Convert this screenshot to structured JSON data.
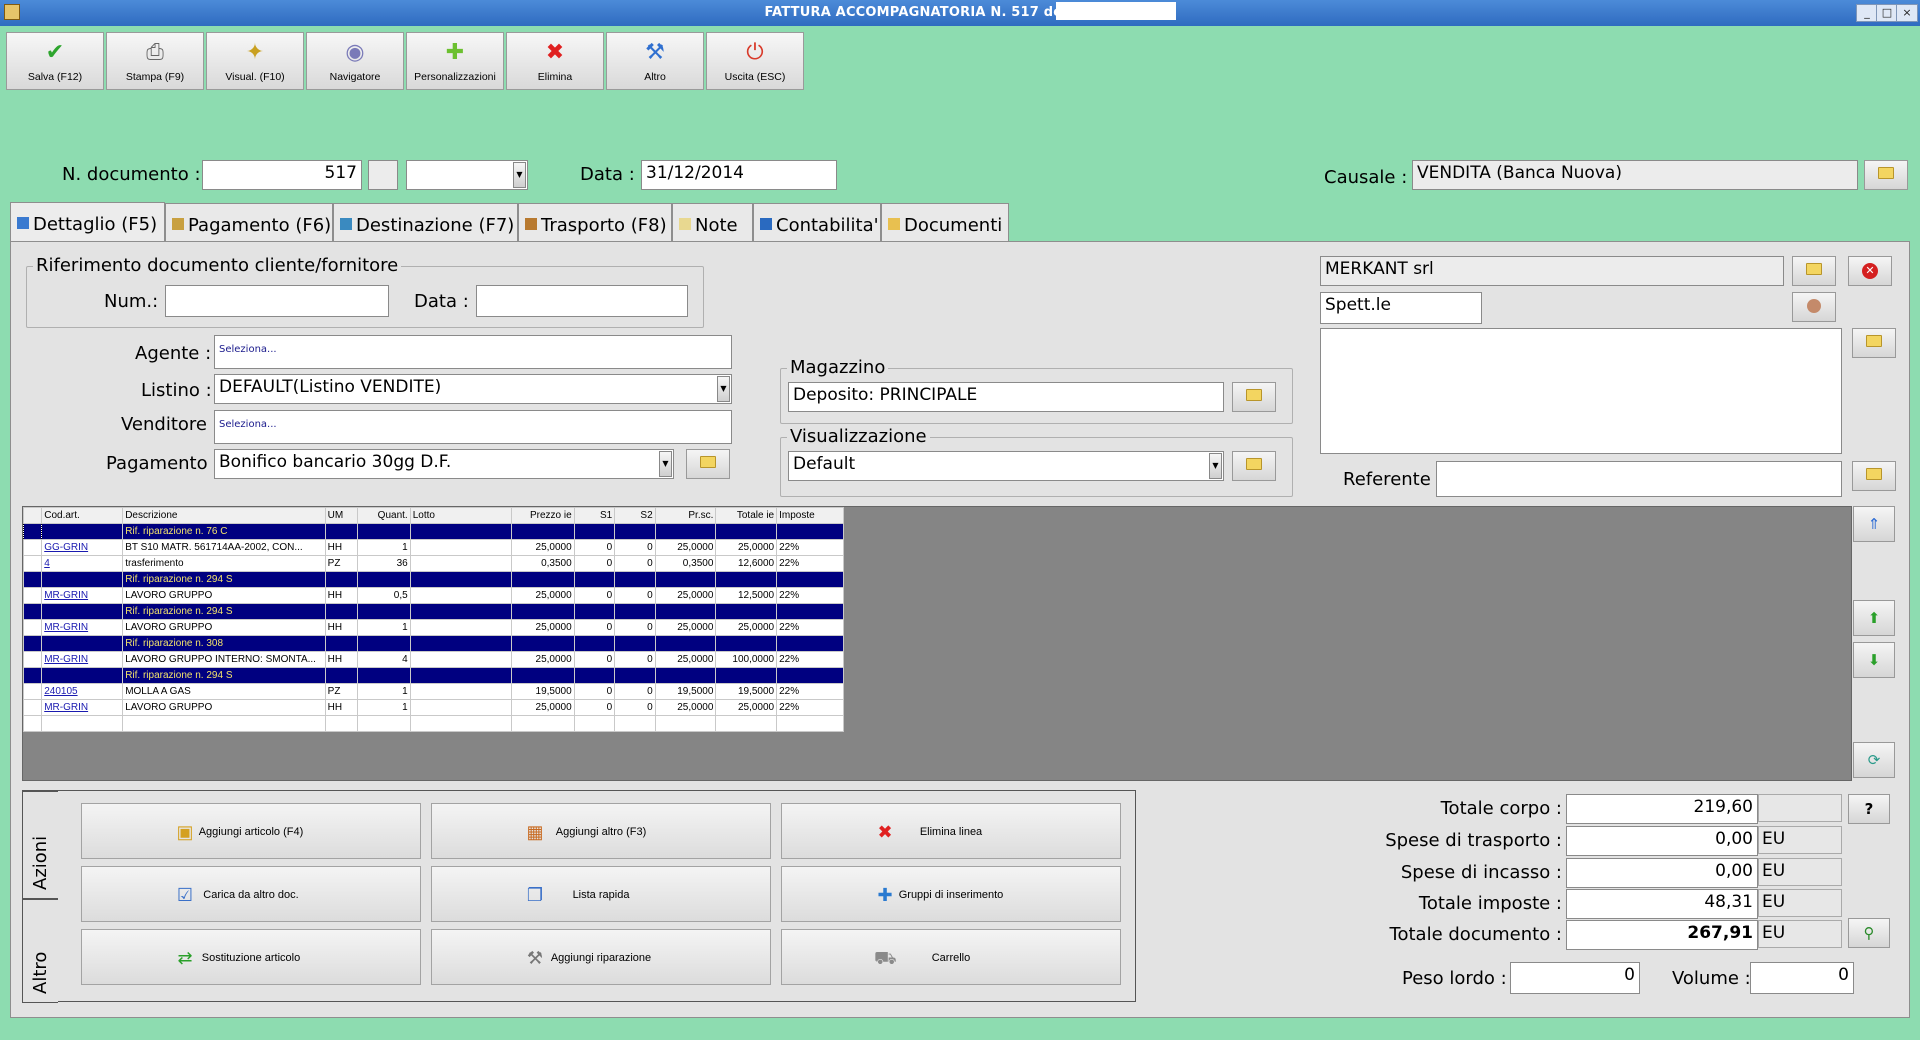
{
  "window": {
    "title": "FATTURA ACCOMPAGNATORIA N. 517 del 31/12/2014",
    "minimize": "_",
    "maximize": "□",
    "close": "×"
  },
  "toolbar": [
    {
      "label": "Salva (F12)",
      "icon": "check-icon",
      "color": "#2ea52e"
    },
    {
      "label": "Stampa (F9)",
      "icon": "printer-icon",
      "color": "#666666"
    },
    {
      "label": "Visual. (F10)",
      "icon": "magic-wand-icon",
      "color": "#c9a020"
    },
    {
      "label": "Navigatore",
      "icon": "navigator-icon",
      "color": "#7a7ab8"
    },
    {
      "label": "Personalizzazioni",
      "icon": "puzzle-icon",
      "color": "#6cc030"
    },
    {
      "label": "Elimina",
      "icon": "red-x-icon",
      "color": "#e02020"
    },
    {
      "label": "Altro",
      "icon": "tools-icon",
      "color": "#3070d0"
    },
    {
      "label": "Uscita (ESC)",
      "icon": "power-icon",
      "color": "#d83a2a"
    }
  ],
  "header": {
    "ndoc_label": "N. documento :",
    "ndoc_value": "517",
    "data_label": "Data :",
    "data_value": "31/12/2014",
    "causale_label": "Causale :",
    "causale_value": "VENDITA (Banca Nuova)"
  },
  "tabs": [
    {
      "label": "Dettaglio (F5)"
    },
    {
      "label": "Pagamento (F6)"
    },
    {
      "label": "Destinazione (F7)"
    },
    {
      "label": "Trasporto (F8)"
    },
    {
      "label": "Note"
    },
    {
      "label": "Contabilita'"
    },
    {
      "label": "Documenti"
    }
  ],
  "riferimento": {
    "title": "Riferimento documento cliente/fornitore",
    "num_label": "Num.:",
    "num_value": "",
    "data_label": "Data :",
    "data_value": ""
  },
  "fields": {
    "agente_label": "Agente :",
    "agente_value": "Seleziona...",
    "listino_label": "Listino :",
    "listino_value": "DEFAULT(Listino VENDITE)",
    "venditore_label": "Venditore :",
    "venditore_value": "Seleziona...",
    "pagamento_label": "Pagamento :",
    "pagamento_value": "Bonifico bancario 30gg D.F."
  },
  "magazzino": {
    "title": "Magazzino",
    "value": "Deposito: PRINCIPALE"
  },
  "visualizzazione": {
    "title": "Visualizzazione",
    "value": "Default"
  },
  "cliente": {
    "name": "MERKANT srl",
    "salutation": "Spett.le",
    "address": "",
    "referente_label": "Referente",
    "referente_value": ""
  },
  "grid": {
    "columns": [
      "Cod.art.",
      "Descrizione",
      "UM",
      "Quant.",
      "Lotto",
      "Prezzo ie",
      "S1",
      "S2",
      "Pr.sc.",
      "Totale ie",
      "Imposte"
    ],
    "rows": [
      {
        "type": "rif",
        "desc": "Rif. riparazione n. 76 C"
      },
      {
        "type": "item",
        "code": "GG-GRIN",
        "desc": "BT S10 MATR. 561714AA-2002, CON...",
        "um": "HH",
        "qty": "1",
        "lotto": "",
        "price": "25,0000",
        "s1": "0",
        "s2": "0",
        "prsc": "25,0000",
        "total": "25,0000",
        "tax": "22%"
      },
      {
        "type": "item",
        "code": "4",
        "desc": "trasferimento",
        "um": "PZ",
        "qty": "36",
        "lotto": "",
        "price": "0,3500",
        "s1": "0",
        "s2": "0",
        "prsc": "0,3500",
        "total": "12,6000",
        "tax": "22%"
      },
      {
        "type": "rif",
        "desc": "Rif. riparazione n. 294 S"
      },
      {
        "type": "item",
        "code": "MR-GRIN",
        "desc": "LAVORO GRUPPO",
        "um": "HH",
        "qty": "0,5",
        "lotto": "",
        "price": "25,0000",
        "s1": "0",
        "s2": "0",
        "prsc": "25,0000",
        "total": "12,5000",
        "tax": "22%"
      },
      {
        "type": "rif",
        "desc": "Rif. riparazione n. 294 S"
      },
      {
        "type": "item",
        "code": "MR-GRIN",
        "desc": "LAVORO GRUPPO",
        "um": "HH",
        "qty": "1",
        "lotto": "",
        "price": "25,0000",
        "s1": "0",
        "s2": "0",
        "prsc": "25,0000",
        "total": "25,0000",
        "tax": "22%"
      },
      {
        "type": "rif",
        "desc": "Rif. riparazione n. 308"
      },
      {
        "type": "item",
        "code": "MR-GRIN",
        "desc": "LAVORO GRUPPO INTERNO: SMONTA...",
        "um": "HH",
        "qty": "4",
        "lotto": "",
        "price": "25,0000",
        "s1": "0",
        "s2": "0",
        "prsc": "25,0000",
        "total": "100,0000",
        "tax": "22%"
      },
      {
        "type": "rif",
        "desc": "Rif. riparazione n. 294 S"
      },
      {
        "type": "item",
        "code": "240105",
        "desc": "MOLLA A GAS",
        "um": "PZ",
        "qty": "1",
        "lotto": "",
        "price": "19,5000",
        "s1": "0",
        "s2": "0",
        "prsc": "19,5000",
        "total": "19,5000",
        "tax": "22%"
      },
      {
        "type": "item",
        "code": "MR-GRIN",
        "desc": "LAVORO GRUPPO",
        "um": "HH",
        "qty": "1",
        "lotto": "",
        "price": "25,0000",
        "s1": "0",
        "s2": "0",
        "prsc": "25,0000",
        "total": "25,0000",
        "tax": "22%"
      },
      {
        "type": "empty"
      }
    ]
  },
  "actions": {
    "tab_azioni": "Azioni",
    "tab_altro": "Altro",
    "buttons": [
      {
        "label": "Aggiungi articolo (F4)",
        "icon": "box-add-icon"
      },
      {
        "label": "Aggiungi altro (F3)",
        "icon": "grid-add-icon"
      },
      {
        "label": "Elimina linea",
        "icon": "red-x-icon"
      },
      {
        "label": "Carica da altro doc.",
        "icon": "checklist-icon"
      },
      {
        "label": "Lista rapida",
        "icon": "document-add-icon"
      },
      {
        "label": "Gruppi di inserimento",
        "icon": "group-add-icon"
      },
      {
        "label": "Sostituzione articolo",
        "icon": "replace-icon"
      },
      {
        "label": "Aggiungi riparazione",
        "icon": "wrench-icon"
      },
      {
        "label": "Carrello",
        "icon": "cart-icon"
      }
    ]
  },
  "totals": {
    "corpo_label": "Totale corpo :",
    "corpo_value": "219,60",
    "trasporto_label": "Spese di trasporto :",
    "trasporto_value": "0,00",
    "incasso_label": "Spese di incasso :",
    "incasso_value": "0,00",
    "imposte_label": "Totale imposte :",
    "imposte_value": "48,31",
    "documento_label": "Totale documento :",
    "documento_value": "267,91",
    "currency": "EU",
    "help": "?",
    "peso_label": "Peso lordo :",
    "peso_value": "0",
    "volume_label": "Volume :",
    "volume_value": "0"
  }
}
